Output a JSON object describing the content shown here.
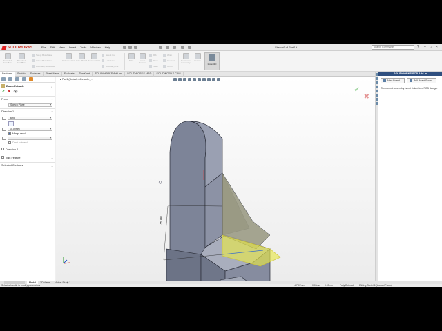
{
  "app": {
    "name": "SOLIDWORKS",
    "document_title": "Sketch6 of Part1 *",
    "menus": [
      "File",
      "Edit",
      "View",
      "Insert",
      "Tools",
      "Window",
      "Help"
    ],
    "search_placeholder": "Search Commands"
  },
  "ribbon": {
    "disabled_buttons": [
      {
        "label": "Extruded Boss/Base"
      },
      {
        "label": "Revolved Boss/Base"
      },
      {
        "label": "Extruded Cut"
      },
      {
        "label": "Hole Wizard"
      },
      {
        "label": "Revolved Cut"
      },
      {
        "label": "Fillet"
      },
      {
        "label": "Linear Pattern"
      },
      {
        "label": "Reference Geometry"
      },
      {
        "label": "Curves"
      }
    ],
    "small_items": [
      "Swept Boss/Base",
      "Lofted Boss/Base",
      "Boundary Boss/Base",
      "Swept Cut",
      "Lofted Cut",
      "Boundary Cut",
      "Rib",
      "Draft",
      "Shell",
      "Wrap",
      "Intersect",
      "Mirror"
    ],
    "active_button": "Instant3D"
  },
  "command_tabs": [
    "Features",
    "Sketch",
    "Surfaces",
    "Sheet Metal",
    "Evaluate",
    "DimXpert",
    "SOLIDWORKS Add-Ins",
    "SOLIDWORKS MBD",
    "SOLIDWORKS CAM"
  ],
  "property_manager": {
    "title": "Boss-Extrude",
    "from_label": "From",
    "from_value": "Sketch Plane",
    "direction1_label": "Direction 1",
    "end_condition": "Blind",
    "depth": "10.00mm",
    "merge_result": "Merge result",
    "draft_outward": "Draft outward",
    "direction2_label": "Direction 2",
    "thin_feature_label": "Thin Feature",
    "selected_contours_label": "Selected Contours"
  },
  "viewport": {
    "breadcrumb": "Part1 (Default<<Default>_...",
    "dimension": "35.00"
  },
  "task_pane": {
    "title": "SOLIDWORKS PCB Add-in",
    "buttons": [
      "New Board...",
      "Pull Board From..."
    ],
    "note": "The current assembly is not linked to a PCB design."
  },
  "bottom_tabs": [
    "Model",
    "3D Views",
    "Motion Study 1"
  ],
  "status": {
    "message": "Select a handle to modify parameters",
    "x": "-27.07mm",
    "y": "0.00mm",
    "z": "0.00mm",
    "state": "Fully Defined",
    "editing": "Editing Sketch6 (Locked Focus)"
  },
  "colors": {
    "brand": "#cc2222",
    "model_gray": "#7d8498",
    "preview_yellow": "#e8e84a"
  }
}
